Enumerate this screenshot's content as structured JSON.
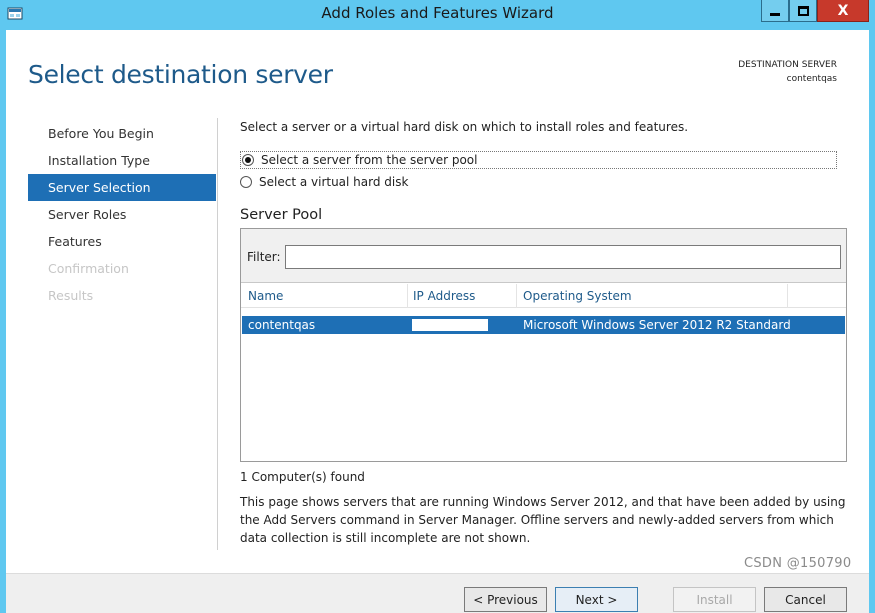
{
  "window": {
    "title": "Add Roles and Features Wizard",
    "close_glyph": "X"
  },
  "page": {
    "title": "Select destination server",
    "destination_label": "DESTINATION SERVER",
    "destination_name": "contentqas"
  },
  "nav": {
    "items": [
      {
        "label": "Before You Begin",
        "state": "normal"
      },
      {
        "label": "Installation Type",
        "state": "normal"
      },
      {
        "label": "Server Selection",
        "state": "active"
      },
      {
        "label": "Server Roles",
        "state": "normal"
      },
      {
        "label": "Features",
        "state": "normal"
      },
      {
        "label": "Confirmation",
        "state": "disabled"
      },
      {
        "label": "Results",
        "state": "disabled"
      }
    ]
  },
  "main": {
    "intro": "Select a server or a virtual hard disk on which to install roles and features.",
    "options": [
      {
        "label": "Select a server from the server pool",
        "checked": true
      },
      {
        "label": "Select a virtual hard disk",
        "checked": false
      }
    ],
    "pool_title": "Server Pool",
    "filter_label": "Filter:",
    "filter_value": "",
    "columns": [
      "Name",
      "IP Address",
      "Operating System"
    ],
    "rows": [
      {
        "name": "contentqas",
        "ip": "",
        "os": "Microsoft Windows Server 2012 R2 Standard",
        "selected": true
      }
    ],
    "found_text": "1 Computer(s) found",
    "description": "This page shows servers that are running Windows Server 2012, and that have been added by using the Add Servers command in Server Manager. Offline servers and newly-added servers from which data collection is still incomplete are not shown."
  },
  "footer": {
    "previous": "< Previous",
    "next": "Next >",
    "install": "Install",
    "cancel": "Cancel",
    "watermark": "CSDN @150790"
  },
  "colors": {
    "titlebar": "#5fc8f0",
    "accent": "#1e6fb5",
    "close": "#c7392b"
  }
}
